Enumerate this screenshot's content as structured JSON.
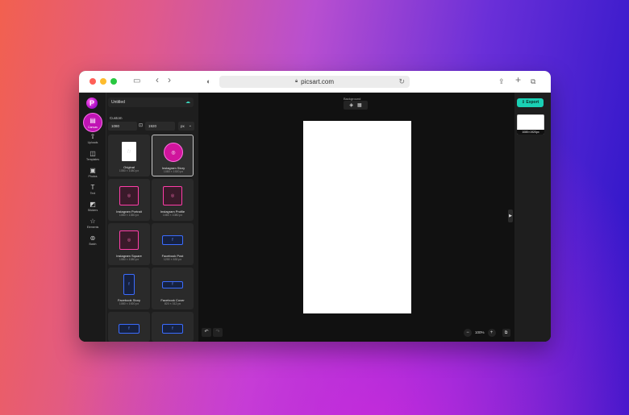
{
  "browser": {
    "url": "picsart.com",
    "lock_icon": "lock-icon",
    "reload_icon": "reload-icon",
    "share_icon": "share-icon",
    "new_tab_icon": "plus-icon",
    "tabs_icon": "tabs-overview-icon"
  },
  "app": {
    "logo": "P",
    "title": "Untitled",
    "export_label": "Export",
    "accent_color": "#1ad0b4",
    "brand_color": "#c014b4"
  },
  "leftnav": {
    "active": {
      "label": "Canvas",
      "icon": "canvas-icon"
    },
    "items": [
      {
        "label": "Uploads",
        "icon": "upload-icon"
      },
      {
        "label": "Templates",
        "icon": "templates-icon"
      },
      {
        "label": "Photos",
        "icon": "photos-icon"
      },
      {
        "label": "Text",
        "icon": "text-icon"
      },
      {
        "label": "Stickers",
        "icon": "stickers-icon"
      },
      {
        "label": "Elements",
        "icon": "elements-icon"
      },
      {
        "label": "Batch",
        "icon": "batch-icon"
      }
    ]
  },
  "size_panel": {
    "custom_label": "Custom",
    "width": "1080",
    "height": "1920",
    "unit": "px",
    "presets": [
      {
        "name": "Original",
        "dims": "1080 × 1080 px",
        "selected": false
      },
      {
        "name": "Instagram Story",
        "dims": "1080 × 1920 px",
        "selected": true
      },
      {
        "name": "Instagram Portrait",
        "dims": "1080 × 1350 px",
        "selected": false
      },
      {
        "name": "Instagram Profile",
        "dims": "1080 × 1080 px",
        "selected": false
      },
      {
        "name": "Instagram Square",
        "dims": "1080 × 1080 px",
        "selected": false
      },
      {
        "name": "Facebook Post",
        "dims": "1200 × 630 px",
        "selected": false
      },
      {
        "name": "Facebook Story",
        "dims": "1080 × 1920 px",
        "selected": false
      },
      {
        "name": "Facebook Cover",
        "dims": "820 × 312 px",
        "selected": false
      },
      {
        "name": "",
        "dims": "",
        "selected": false
      },
      {
        "name": "",
        "dims": "",
        "selected": false
      }
    ]
  },
  "canvas": {
    "background_label": "Background",
    "zoom": "100%"
  },
  "pages": {
    "thumb_label": "1080×1920px"
  }
}
